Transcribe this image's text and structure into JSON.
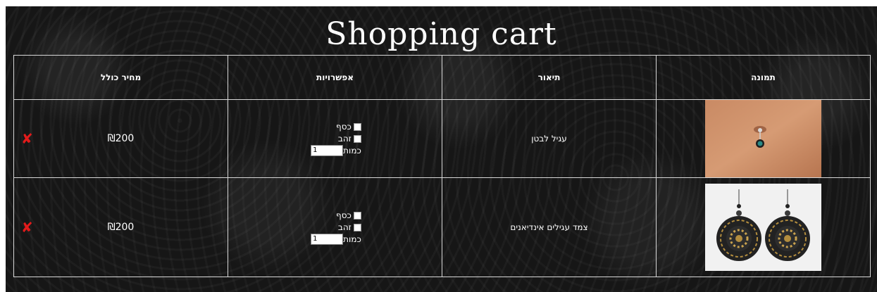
{
  "page": {
    "title": "Shopping cart"
  },
  "table": {
    "headers": {
      "image": "תמונה",
      "description": "תיאור",
      "options": "אפשרויות",
      "total_price": "מחיר כולל"
    }
  },
  "items": [
    {
      "image_alt": "belly-ring-photo",
      "description": "עגיל לבטן",
      "options": {
        "silver_label": "כסף",
        "gold_label": "זהב",
        "qty_label": "כמות",
        "qty_value": "1"
      },
      "price": "₪200",
      "remove_icon": "red-x-icon"
    },
    {
      "image_alt": "earrings-photo",
      "description": "צמד עגילים אינדיאנים",
      "options": {
        "silver_label": "כסף",
        "gold_label": "זהב",
        "qty_label": "כמות",
        "qty_value": "1"
      },
      "price": "₪200",
      "remove_icon": "red-x-icon"
    }
  ],
  "colors": {
    "background": "#161616",
    "border": "#d8d8d8",
    "remove": "#e21b1b",
    "text": "#ffffff"
  }
}
